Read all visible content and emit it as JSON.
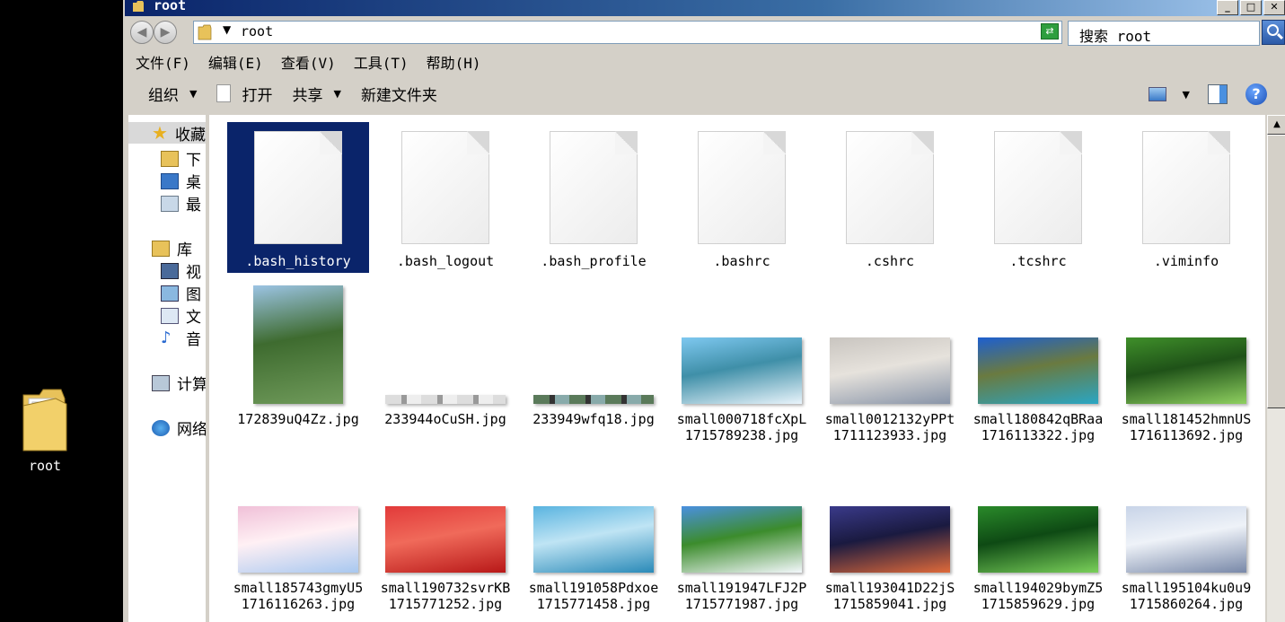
{
  "desktop": {
    "icon_label": "root"
  },
  "window": {
    "title": "root",
    "min": "_",
    "max": "□",
    "close": "✕"
  },
  "address": {
    "path": "root",
    "search_placeholder": "搜索 root"
  },
  "menu": [
    "文件(F)",
    "编辑(E)",
    "查看(V)",
    "工具(T)",
    "帮助(H)"
  ],
  "toolbar": {
    "organize": "组织",
    "open": "打开",
    "share": "共享",
    "new_folder": "新建文件夹",
    "help": "?"
  },
  "nav": {
    "favorites": "收藏",
    "fav_items": [
      "下",
      "桌",
      "最"
    ],
    "library": "库",
    "lib_items": [
      "视",
      "图",
      "文",
      "音"
    ],
    "computer": "计算",
    "network": "网络"
  },
  "files": [
    {
      "name": ".bash_history",
      "type": "doc",
      "selected": true
    },
    {
      "name": ".bash_logout",
      "type": "doc"
    },
    {
      "name": ".bash_profile",
      "type": "doc"
    },
    {
      "name": ".bashrc",
      "type": "doc"
    },
    {
      "name": ".cshrc",
      "type": "doc"
    },
    {
      "name": ".tcshrc",
      "type": "doc"
    },
    {
      "name": ".viminfo",
      "type": "doc"
    },
    {
      "name": "172839uQ4Zz.jpg",
      "type": "img",
      "colors": [
        "#9cc4e4",
        "#6f9a5a",
        "#3e6b2f"
      ]
    },
    {
      "name": "233944oCuSH.jpg",
      "type": "img",
      "colors": [
        "#ddd",
        "#999",
        "#eee"
      ]
    },
    {
      "name": "233949wfq18.jpg",
      "type": "img",
      "colors": [
        "#5a7a5a",
        "#333",
        "#8aa"
      ]
    },
    {
      "name": "small000718fcXpL1715789238.jpg",
      "type": "img",
      "colors": [
        "#7ec8f0",
        "#e9f4fb",
        "#3f8fa8"
      ]
    },
    {
      "name": "small0012132yPPt1711123933.jpg",
      "type": "img",
      "colors": [
        "#c9c5c0",
        "#8894a8",
        "#e6e2dc"
      ]
    },
    {
      "name": "small180842qBRaa1716113322.jpg",
      "type": "img",
      "colors": [
        "#1d5fd0",
        "#2aa6c4",
        "#6a7a40"
      ]
    },
    {
      "name": "small181452hmnUS1716113692.jpg",
      "type": "img",
      "colors": [
        "#3f8f2a",
        "#8fd060",
        "#1f5218"
      ]
    },
    {
      "name": "small185743gmyU51716116263.jpg",
      "type": "img",
      "colors": [
        "#f0c0d8",
        "#a8c8f0",
        "#fff0f4"
      ]
    },
    {
      "name": "small190732svrKB1715771252.jpg",
      "type": "img",
      "colors": [
        "#e23a3a",
        "#b81818",
        "#f06a5a"
      ]
    },
    {
      "name": "small191058Pdxoe1715771458.jpg",
      "type": "img",
      "colors": [
        "#5ab4e0",
        "#2a8ab8",
        "#bfe4f4"
      ]
    },
    {
      "name": "small191947LFJ2P1715771987.jpg",
      "type": "img",
      "colors": [
        "#4a90e0",
        "#f4f8fc",
        "#3c8c2c"
      ]
    },
    {
      "name": "small193041D22jS1715859041.jpg",
      "type": "img",
      "colors": [
        "#3a3a8a",
        "#e06a3a",
        "#1a1a40"
      ]
    },
    {
      "name": "small194029bymZ51715859629.jpg",
      "type": "img",
      "colors": [
        "#2a8a2a",
        "#7ad05a",
        "#0e4a14"
      ]
    },
    {
      "name": "small195104ku0u91715860264.jpg",
      "type": "img",
      "colors": [
        "#c8d4e8",
        "#7888a8",
        "#eef2f8"
      ]
    }
  ]
}
